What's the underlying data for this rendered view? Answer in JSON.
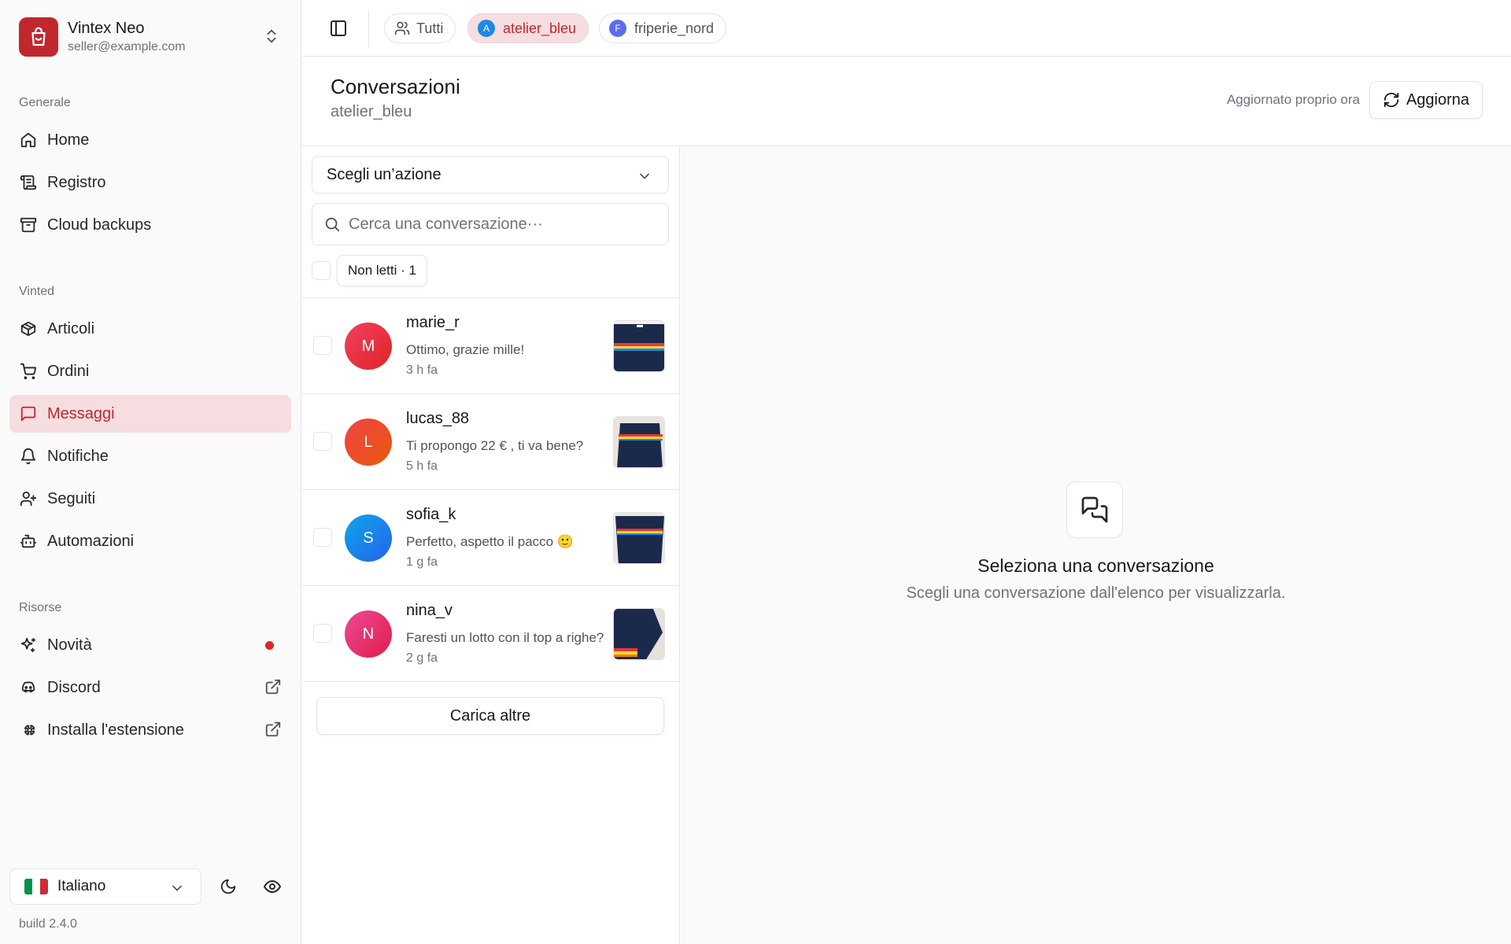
{
  "app": {
    "name": "Vintex Neo",
    "email": "seller@example.com",
    "build": "build 2.4.0",
    "accent_color": "#c0282e"
  },
  "sidebar": {
    "groups": [
      {
        "label": "Generale",
        "items": [
          {
            "label": "Home",
            "icon": "home-icon"
          },
          {
            "label": "Registro",
            "icon": "ledger-icon"
          },
          {
            "label": "Cloud backups",
            "icon": "archive-icon"
          }
        ]
      },
      {
        "label": "Vinted",
        "items": [
          {
            "label": "Articoli",
            "icon": "package-icon"
          },
          {
            "label": "Ordini",
            "icon": "cart-icon"
          },
          {
            "label": "Messaggi",
            "icon": "message-square-icon",
            "active": true
          },
          {
            "label": "Notifiche",
            "icon": "bell-icon"
          },
          {
            "label": "Seguiti",
            "icon": "user-plus-icon"
          },
          {
            "label": "Automazioni",
            "icon": "bot-icon"
          }
        ]
      },
      {
        "label": "Risorse",
        "items": [
          {
            "label": "Novità",
            "icon": "sparkles-icon",
            "badge": "new-dot"
          },
          {
            "label": "Discord",
            "icon": "discord-icon",
            "external": true
          },
          {
            "label": "Installa l'estensione",
            "icon": "puzzle-icon",
            "external": true
          }
        ]
      }
    ],
    "language": "Italiano"
  },
  "topbar": {
    "accounts": [
      {
        "label": "Tutti",
        "icon": "users-icon"
      },
      {
        "label": "atelier_bleu",
        "initial": "A",
        "color": "#1e88e5",
        "active": true
      },
      {
        "label": "friperie_nord",
        "initial": "F",
        "color": "#5b6cf0"
      }
    ]
  },
  "header": {
    "title": "Conversazioni",
    "subtitle": "atelier_bleu",
    "updated_text": "Aggiornato proprio ora",
    "refresh_label": "Aggiorna"
  },
  "list": {
    "action_placeholder": "Scegli un’azione",
    "search_placeholder": "Cerca una conversazione···",
    "filter_label": "Non letti · 1",
    "conversations": [
      {
        "name": "marie_r",
        "initial": "M",
        "message": "Ottimo, grazie mille!",
        "time": "3 h fa",
        "avatar_from": "#f43f5e",
        "avatar_to": "#dc2626"
      },
      {
        "name": "lucas_88",
        "initial": "L",
        "message": "Ti propongo 22 € , ti va bene?",
        "time": "5 h fa",
        "avatar_from": "#ef4444",
        "avatar_to": "#ea580c"
      },
      {
        "name": "sofia_k",
        "initial": "S",
        "message": "Perfetto, aspetto il pacco 🙂",
        "time": "1 g fa",
        "avatar_from": "#0ea5e9",
        "avatar_to": "#2563eb"
      },
      {
        "name": "nina_v",
        "initial": "N",
        "message": "Faresti un lotto con il top a righe?",
        "time": "2 g fa",
        "avatar_from": "#ec4899",
        "avatar_to": "#e11d48"
      }
    ],
    "load_more_label": "Carica altre"
  },
  "empty_state": {
    "title": "Seleziona una conversazione",
    "subtitle": "Scegli una conversazione dall'elenco per visualizzarla."
  }
}
